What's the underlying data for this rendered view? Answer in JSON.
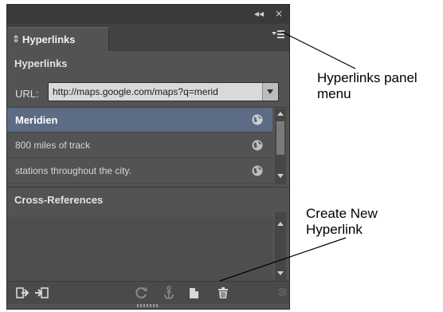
{
  "panel": {
    "title_controls": {
      "collapse": "◂◂",
      "close": "×"
    },
    "tab": {
      "chevron": "⌃⌄",
      "label": "Hyperlinks"
    },
    "menu_icon": "panel-menu-icon",
    "hyperlinks_section": {
      "heading": "Hyperlinks",
      "url_label": "URL:",
      "url_value": "http://maps.google.com/maps?q=merid"
    },
    "hyperlinks": [
      {
        "label": "Meridien",
        "selected": true,
        "icon": "globe-icon"
      },
      {
        "label": "800 miles of track",
        "selected": false,
        "icon": "globe-icon"
      },
      {
        "label": "stations throughout the city.",
        "selected": false,
        "icon": "globe-icon"
      }
    ],
    "cross_references_section": {
      "heading": "Cross-References"
    },
    "bottom_bar_icons": [
      "go-to-source-icon",
      "go-to-destination-icon",
      "update-icon",
      "anchor-icon",
      "create-new-hyperlink-icon",
      "delete-icon"
    ]
  },
  "callouts": {
    "menu": {
      "line1": "Hyperlinks panel",
      "line2": "menu"
    },
    "create": {
      "line1": "Create New",
      "line2": "Hyperlink"
    }
  },
  "colors": {
    "panel_bg": "#535353",
    "selected_row": "#5d6c85",
    "titlebar": "#3a3a3a"
  }
}
